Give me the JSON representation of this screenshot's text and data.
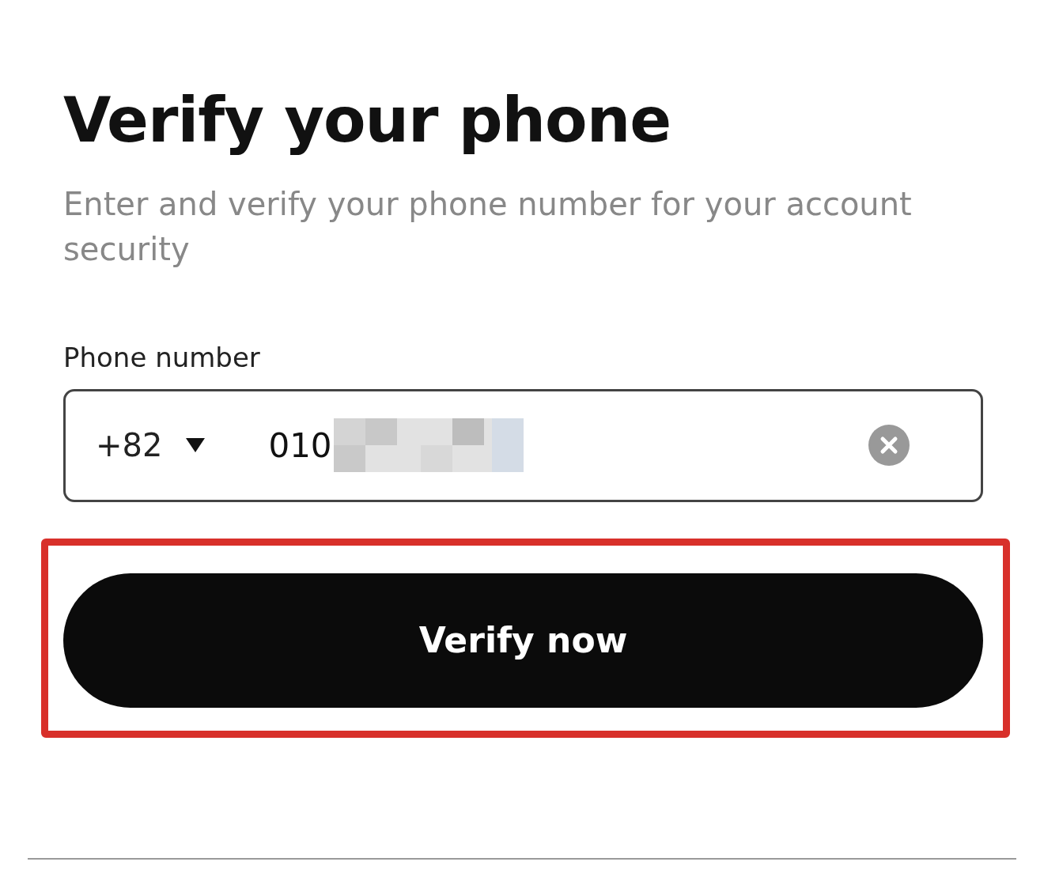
{
  "title": "Verify your phone",
  "subtitle": "Enter and verify your phone number for your account security",
  "phone_field": {
    "label": "Phone number",
    "country_code": "+82",
    "value": "010",
    "redacted": true
  },
  "verify_button": {
    "label": "Verify now",
    "highlighted": true
  }
}
